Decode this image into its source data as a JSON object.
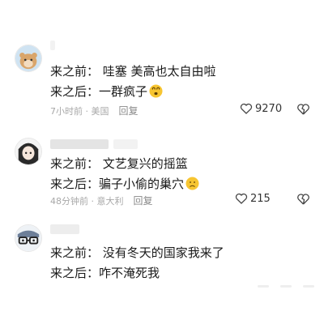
{
  "comments": [
    {
      "line1": "来之前：  哇塞 美高也太自由啦",
      "line2": "来之后：一群疯子",
      "time": "7小时前 · 美国",
      "reply": "回复",
      "likes": "9270",
      "avatar_icon": "hamster-avatar",
      "emoji_icon": "dizzy-face-emoji"
    },
    {
      "line1": "来之前：  文艺复兴的摇篮",
      "line2": "来之后：骗子小偷的巢穴",
      "time": "48分钟前 · 意大利",
      "reply": "回复",
      "likes": "215",
      "avatar_icon": "anime-girl-avatar",
      "emoji_icon": "frowning-face-emoji"
    },
    {
      "line1": "来之前：  没有冬天的国家我来了",
      "line2": "来之后：咋不淹死我",
      "avatar_icon": "glasses-face-avatar"
    }
  ],
  "colors": {
    "text": "#1a1a1a",
    "meta": "#a8a8a8",
    "emoji": "#f7c531"
  }
}
